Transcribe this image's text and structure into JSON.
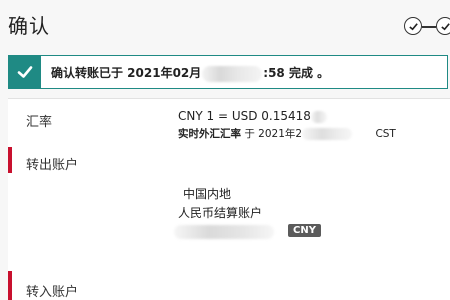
{
  "header": {
    "title": "确认",
    "step_icons": [
      "check-icon",
      "check-icon"
    ]
  },
  "banner": {
    "prefix": "确认转账已于 2021年02月",
    "suffix": ":58 完成 。",
    "icon": "check-icon",
    "accent_color": "#1f8a84"
  },
  "rate": {
    "label": "汇率",
    "value": "CNY 1 = USD 0.15418",
    "sub_bold": "实时外汇汇率",
    "sub_mid": "于 2021年2",
    "sub_tz": "CST"
  },
  "from_account": {
    "label": "转出账户",
    "region": "中国内地",
    "type": "人民币结算账户",
    "currency_badge": "CNY"
  },
  "to_account": {
    "label": "转入账户"
  },
  "colors": {
    "brand_red": "#c8102e"
  }
}
